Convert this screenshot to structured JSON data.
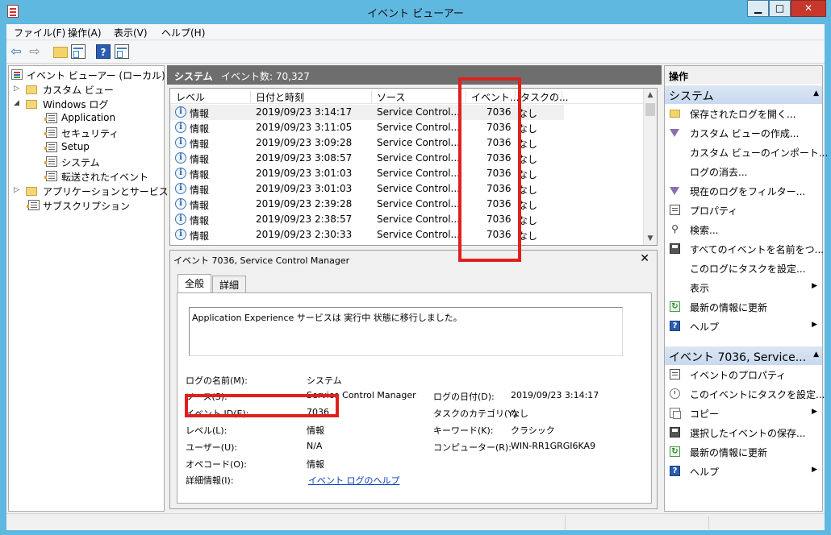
{
  "window": {
    "title": "イベント ビューアー",
    "minimize": "▁",
    "maximize": "□",
    "close": "✕"
  },
  "menu": [
    "ファイル(F)",
    "操作(A)",
    "表示(V)",
    "ヘルプ(H)"
  ],
  "toolbar": {
    "back": "⇦",
    "forward": "⇨",
    "help": "?"
  },
  "tree": {
    "root": "イベント ビューアー (ローカル)",
    "custom_views": "カスタム ビュー",
    "windows_logs": "Windows ログ",
    "logs": [
      "Application",
      "セキュリティ",
      "Setup",
      "システム",
      "転送されたイベント"
    ],
    "app_services": "アプリケーションとサービス ログ",
    "subscriptions": "サブスクリプション",
    "expand_collapsed": "▷",
    "expand_open": "◢"
  },
  "center": {
    "header_title": "システム",
    "header_count": "イベント数: 70,327",
    "columns": [
      "レベル",
      "日付と時刻",
      "ソース",
      "イベント...",
      "タスクの..."
    ],
    "rows": [
      {
        "level": "情報",
        "datetime": "2019/09/23 3:14:17",
        "source": "Service Control...",
        "event_id": "7036",
        "task": "なし"
      },
      {
        "level": "情報",
        "datetime": "2019/09/23 3:11:05",
        "source": "Service Control...",
        "event_id": "7036",
        "task": "なし"
      },
      {
        "level": "情報",
        "datetime": "2019/09/23 3:09:28",
        "source": "Service Control...",
        "event_id": "7036",
        "task": "なし"
      },
      {
        "level": "情報",
        "datetime": "2019/09/23 3:08:57",
        "source": "Service Control...",
        "event_id": "7036",
        "task": "なし"
      },
      {
        "level": "情報",
        "datetime": "2019/09/23 3:01:03",
        "source": "Service Control...",
        "event_id": "7036",
        "task": "なし"
      },
      {
        "level": "情報",
        "datetime": "2019/09/23 3:01:03",
        "source": "Service Control...",
        "event_id": "7036",
        "task": "なし"
      },
      {
        "level": "情報",
        "datetime": "2019/09/23 2:39:28",
        "source": "Service Control...",
        "event_id": "7036",
        "task": "なし"
      },
      {
        "level": "情報",
        "datetime": "2019/09/23 2:38:57",
        "source": "Service Control...",
        "event_id": "7036",
        "task": "なし"
      },
      {
        "level": "情報",
        "datetime": "2019/09/23 2:30:33",
        "source": "Service Control...",
        "event_id": "7036",
        "task": "なし"
      }
    ],
    "info_glyph": "i"
  },
  "detail": {
    "title": "イベント 7036, Service Control Manager",
    "close": "✕",
    "tabs": [
      "全般",
      "詳細"
    ],
    "message": "Application Experience サービスは 実行中 状態に移行しました。",
    "props": {
      "log_name_label": "ログの名前(M):",
      "log_name": "システム",
      "source_label": "ソース(S):",
      "source": "Service Control Manager",
      "logged_label": "ログの日付(D):",
      "logged": "2019/09/23 3:14:17",
      "event_id_label": "イベント ID(E):",
      "event_id": "7036",
      "task_label": "タスクのカテゴリ(Y):",
      "task": "なし",
      "level_label": "レベル(L):",
      "level": "情報",
      "keywords_label": "キーワード(K):",
      "keywords": "クラシック",
      "user_label": "ユーザー(U):",
      "user": "N/A",
      "computer_label": "コンピューター(R):",
      "computer": "WIN-RR1GRGI6KA9",
      "opcode_label": "オペコード(O):",
      "opcode": "情報",
      "more_info_label": "詳細情報(I):",
      "more_info_link": "イベント ログのヘルプ"
    }
  },
  "actions": {
    "title": "操作",
    "section1": "システム",
    "items1": [
      "保存されたログを開く...",
      "カスタム ビューの作成...",
      "カスタム ビューのインポート...",
      "ログの消去...",
      "現在のログをフィルター...",
      "プロパティ",
      "検索...",
      "すべてのイベントを名前をつ...",
      "このログにタスクを設定...",
      "表示",
      "最新の情報に更新",
      "ヘルプ"
    ],
    "section2": "イベント 7036, Service...",
    "items2": [
      "イベントのプロパティ",
      "このイベントにタスクを設定...",
      "コピー",
      "選択したイベントの保存...",
      "最新の情報に更新",
      "ヘルプ"
    ],
    "collapse": "▲",
    "submenu": "▶"
  }
}
